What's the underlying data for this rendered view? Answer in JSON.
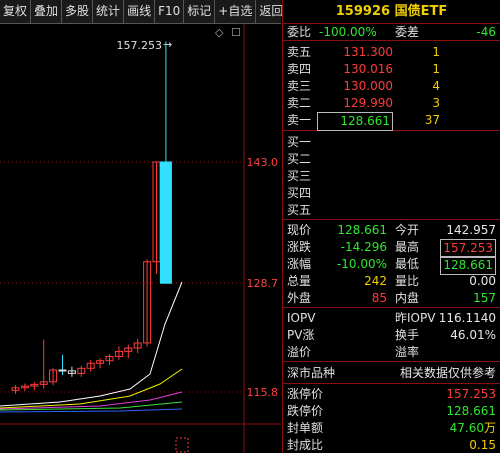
{
  "toolbar": {
    "buttons": [
      "复权",
      "叠加",
      "多股",
      "统计",
      "画线",
      "F10",
      "标记",
      "+自选",
      "返回"
    ]
  },
  "chart": {
    "peak_label": "157.253",
    "arrow": "→",
    "price_labels": [
      "143.0",
      "128.7",
      "115.8"
    ],
    "corner_glyph": "◇",
    "corner_glyph2": "☐",
    "candles": [
      {
        "o": 116.0,
        "h": 116.6,
        "l": 115.6,
        "c": 116.3
      },
      {
        "o": 116.3,
        "h": 116.8,
        "l": 115.9,
        "c": 116.5
      },
      {
        "o": 116.5,
        "h": 117.0,
        "l": 116.0,
        "c": 116.7
      },
      {
        "o": 116.7,
        "h": 122.0,
        "l": 116.2,
        "c": 117.0
      },
      {
        "o": 117.0,
        "h": 118.6,
        "l": 116.6,
        "c": 118.4
      },
      {
        "o": 118.4,
        "h": 120.2,
        "l": 117.8,
        "c": 118.3
      },
      {
        "o": 118.3,
        "h": 118.8,
        "l": 117.6,
        "c": 118.0
      },
      {
        "o": 118.0,
        "h": 118.9,
        "l": 117.6,
        "c": 118.6
      },
      {
        "o": 118.6,
        "h": 119.6,
        "l": 118.2,
        "c": 119.2
      },
      {
        "o": 119.2,
        "h": 119.8,
        "l": 118.6,
        "c": 119.5
      },
      {
        "o": 119.5,
        "h": 120.3,
        "l": 119.0,
        "c": 120.0
      },
      {
        "o": 120.0,
        "h": 121.2,
        "l": 119.6,
        "c": 120.6
      },
      {
        "o": 120.6,
        "h": 121.4,
        "l": 119.8,
        "c": 121.0
      },
      {
        "o": 121.0,
        "h": 122.1,
        "l": 120.4,
        "c": 121.6
      },
      {
        "o": 121.6,
        "h": 131.5,
        "l": 121.2,
        "c": 131.2
      },
      {
        "o": 131.2,
        "h": 143.0,
        "l": 129.8,
        "c": 143.0
      },
      {
        "o": 143.0,
        "h": 157.253,
        "l": 128.661,
        "c": 128.661
      }
    ]
  },
  "stock": {
    "code": "159926",
    "name": "国债ETF",
    "wei_bi_label": "委比",
    "wei_bi": "-100.00%",
    "wei_cha_label": "委差",
    "wei_cha": "-46"
  },
  "sell": [
    {
      "label": "卖五",
      "price": "131.300",
      "vol": "1"
    },
    {
      "label": "卖四",
      "price": "130.016",
      "vol": "1"
    },
    {
      "label": "卖三",
      "price": "130.000",
      "vol": "4"
    },
    {
      "label": "卖二",
      "price": "129.990",
      "vol": "3"
    },
    {
      "label": "卖一",
      "price": "128.661",
      "vol": "37"
    }
  ],
  "buy": [
    {
      "label": "买一"
    },
    {
      "label": "买二"
    },
    {
      "label": "买三"
    },
    {
      "label": "买四"
    },
    {
      "label": "买五"
    }
  ],
  "quote": {
    "xianjia_label": "现价",
    "xianjia": "128.661",
    "jinkai_label": "今开",
    "jinkai": "142.957",
    "zhangdie_label": "涨跌",
    "zhangdie": "-14.296",
    "zuigao_label": "最高",
    "zuigao": "157.253",
    "zhangfu_label": "涨幅",
    "zhangfu": "-10.00%",
    "zuidi_label": "最低",
    "zuidi": "128.661",
    "zongliang_label": "总量",
    "zongliang": "242",
    "liangbi_label": "量比",
    "liangbi": "0.00",
    "waipan_label": "外盘",
    "waipan": "85",
    "neipan_label": "内盘",
    "neipan": "157"
  },
  "iopv": {
    "iopv_label": "IOPV",
    "zuoiopv_label": "昨IOPV",
    "zuoiopv": "116.1140",
    "pvzhang_label": "PV涨",
    "huanshou_label": "换手",
    "huanshou": "46.01%",
    "yijia_label": "溢价",
    "yilv_label": "溢率"
  },
  "info": {
    "category": "深市品种",
    "note": "相关数据仅供参考"
  },
  "limit": {
    "zhangting_label": "涨停价",
    "zhangting": "157.253",
    "dieting_label": "跌停价",
    "dieting": "128.661",
    "fengdan_label": "封单额",
    "fengdan": "47.60",
    "fengdan_unit": "万",
    "fengcheng_label": "封成比",
    "fengcheng": "0.15"
  },
  "colors": {
    "up": "#ff3b3b",
    "down": "#33e0ff",
    "flat": "#e0e0e0",
    "ma5": "#ffffff",
    "ma10": "#f0f000",
    "ma20": "#e040e0",
    "ma30": "#40e040",
    "ma60": "#3060ff",
    "grid": "#8a1010",
    "axis_text": "#ff4040"
  }
}
